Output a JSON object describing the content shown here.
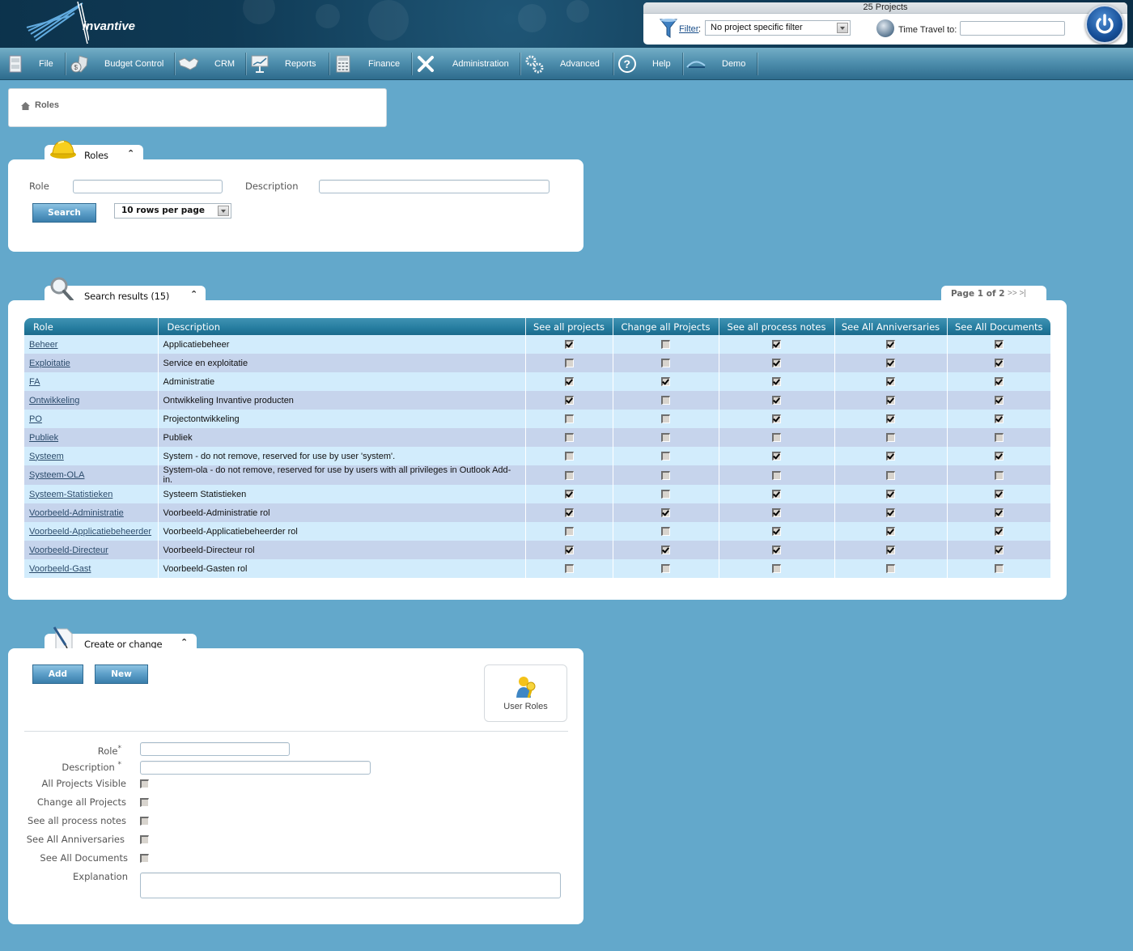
{
  "header": {
    "brand": "invantive",
    "project_count": "25 Projects",
    "filter_link": "Filter",
    "filter_colon": ":",
    "filter_value": "No project specific filter",
    "time_travel_label": "Time Travel to:",
    "time_travel_value": ""
  },
  "menu": [
    {
      "label": "File",
      "icon": "file-cabinet-icon"
    },
    {
      "label": "Budget Control",
      "icon": "money-shield-icon"
    },
    {
      "label": "CRM",
      "icon": "handshake-icon"
    },
    {
      "label": "Reports",
      "icon": "presentation-chart-icon"
    },
    {
      "label": "Finance",
      "icon": "calculator-icon"
    },
    {
      "label": "Administration",
      "icon": "tools-icon"
    },
    {
      "label": "Advanced",
      "icon": "gears-icon"
    },
    {
      "label": "Help",
      "icon": "help-icon"
    },
    {
      "label": "Demo",
      "icon": "demo-logo-icon"
    }
  ],
  "breadcrumb": {
    "label": "Roles"
  },
  "search_panel": {
    "tab_title": "Roles",
    "role_label": "Role",
    "role_value": "",
    "description_label": "Description",
    "description_value": "",
    "search_button": "Search",
    "rows_per_page": "10 rows per page"
  },
  "results": {
    "tab_title": "Search results (15)",
    "pager_text": "Page 1 of 2",
    "pager_nav": ">> >|",
    "columns": [
      "Role",
      "Description",
      "See all projects",
      "Change all Projects",
      "See all process notes",
      "See All Anniversaries",
      "See All Documents"
    ],
    "rows": [
      {
        "role": "Beheer",
        "description": "Applicatiebeheer",
        "flags": [
          true,
          false,
          true,
          true,
          true
        ]
      },
      {
        "role": "Exploitatie",
        "description": "Service en exploitatie",
        "flags": [
          false,
          false,
          true,
          true,
          true
        ]
      },
      {
        "role": "FA",
        "description": "Administratie",
        "flags": [
          true,
          true,
          true,
          true,
          true
        ]
      },
      {
        "role": "Ontwikkeling",
        "description": "Ontwikkeling Invantive producten",
        "flags": [
          true,
          false,
          true,
          true,
          true
        ]
      },
      {
        "role": "PO",
        "description": "Projectontwikkeling",
        "flags": [
          false,
          false,
          true,
          true,
          true
        ]
      },
      {
        "role": "Publiek",
        "description": "Publiek",
        "flags": [
          false,
          false,
          false,
          false,
          false
        ]
      },
      {
        "role": "Systeem",
        "description": "System - do not remove, reserved for use by user 'system'.",
        "flags": [
          false,
          false,
          true,
          true,
          true
        ]
      },
      {
        "role": "Systeem-OLA",
        "description": "System-ola - do not remove, reserved for use by users with all privileges in Outlook Add-in.",
        "flags": [
          false,
          false,
          false,
          false,
          false
        ]
      },
      {
        "role": "Systeem-Statistieken",
        "description": "Systeem Statistieken",
        "flags": [
          true,
          false,
          true,
          true,
          true
        ]
      },
      {
        "role": "Voorbeeld-Administratie",
        "description": "Voorbeeld-Administratie rol",
        "flags": [
          true,
          true,
          true,
          true,
          true
        ]
      },
      {
        "role": "Voorbeeld-Applicatiebeheerder",
        "description": "Voorbeeld-Applicatiebeheerder rol",
        "flags": [
          false,
          false,
          true,
          true,
          true
        ]
      },
      {
        "role": "Voorbeeld-Directeur",
        "description": "Voorbeeld-Directeur rol",
        "flags": [
          true,
          true,
          true,
          true,
          true
        ]
      },
      {
        "role": "Voorbeeld-Gast",
        "description": "Voorbeeld-Gasten rol",
        "flags": [
          false,
          false,
          false,
          false,
          false
        ]
      }
    ]
  },
  "create_panel": {
    "tab_title": "Create or change",
    "add_button": "Add",
    "new_button": "New",
    "user_roles_label": "User Roles",
    "fields": {
      "role_label": "Role",
      "description_label": "Description",
      "required_mark": "*",
      "role_value": "",
      "description_value": "",
      "all_projects_visible_label": "All Projects Visible",
      "all_projects_visible": false,
      "change_all_projects_label": "Change all Projects",
      "change_all_projects": false,
      "see_all_process_notes_label": "See all process notes",
      "see_all_process_notes": false,
      "see_all_anniversaries_label": "See All Anniversaries",
      "see_all_anniversaries": false,
      "see_all_documents_label": "See All Documents",
      "see_all_documents": false,
      "explanation_label": "Explanation",
      "explanation_value": ""
    }
  },
  "colors": {
    "background": "#63a8cb",
    "header_dark": "#0f3a55",
    "table_header": "#257c9f",
    "row_odd": "#d2ecfc",
    "row_even": "#c6d4ec",
    "link": "#2b4b6b"
  }
}
